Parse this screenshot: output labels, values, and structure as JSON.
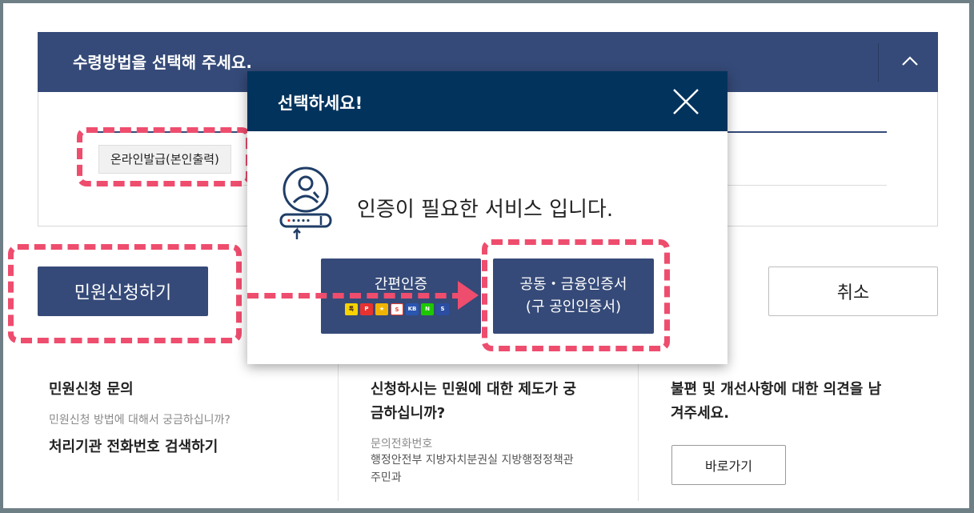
{
  "accordion": {
    "title": "수령방법을 선택해 주세요.",
    "tab_label": "온라인발급(본인출력)"
  },
  "actions": {
    "apply_label": "민원신청하기",
    "cancel_label": "취소"
  },
  "info": {
    "col1": {
      "title": "민원신청 문의",
      "sub": "민원신청 방법에 대해서 궁금하십니까?",
      "link": "처리기관 전화번호 검색하기"
    },
    "col2": {
      "title_line1": "신청하시는 민원에 대한 제도가 궁",
      "title_line2": "금하십니까?",
      "phone_label": "문의전화번호",
      "org_line1": "행정안전부 지방자치분권실 지방행정정책관",
      "org_line2": "주민과"
    },
    "col3": {
      "title_line1": "불편 및 개선사항에 대한 의견을 남",
      "title_line2": "겨주세요.",
      "button": "바로가기"
    }
  },
  "modal": {
    "title": "선택하세요!",
    "message": "인증이 필요한 서비스 입니다.",
    "simple_auth_label": "간편인증",
    "cert_line1": "공동・금융인증서",
    "cert_line2": "(구 공인인증서)",
    "logos": [
      {
        "name": "kakao-logo",
        "color": "#f7d300",
        "text": "톡"
      },
      {
        "name": "pass-logo",
        "color": "#e8322f",
        "text": "PASS"
      },
      {
        "name": "payco-logo",
        "color": "#f0b400",
        "text": "★"
      },
      {
        "name": "samsung-pass-logo",
        "color": "#e84030",
        "text": "S"
      },
      {
        "name": "kb-logo",
        "color": "#2a55b0",
        "text": "KB"
      },
      {
        "name": "naver-logo",
        "color": "#1ec800",
        "text": "N"
      },
      {
        "name": "shinhan-logo",
        "color": "#2b4ea2",
        "text": "S"
      }
    ]
  },
  "colors": {
    "navy": "#354a78",
    "modal_header": "#02335d",
    "highlight": "#ee4d6e"
  }
}
